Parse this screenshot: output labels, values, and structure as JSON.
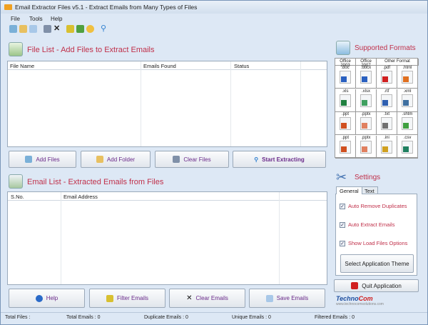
{
  "window": {
    "title": "Email Extractor Files v5.1 - Extract Emails from Many Types of Files"
  },
  "menu": [
    "File",
    "Tools",
    "Help"
  ],
  "toolbar_icons": [
    "add-files-icon",
    "add-folder-icon",
    "copy-icon",
    "window-icon",
    "close-icon",
    "filter-icon",
    "save-icon",
    "key-icon",
    "search-icon"
  ],
  "file_list": {
    "title": "File List - Add Files to Extract Emails",
    "columns": [
      "File Name",
      "Emails Found",
      "Status"
    ],
    "rows": []
  },
  "file_buttons": {
    "add_files": "Add Files",
    "add_folder": "Add Folder",
    "clear_files": "Clear Files",
    "start": "Start Extracting"
  },
  "email_list": {
    "title": "Email List - Extracted Emails from Files",
    "columns": [
      "S.No.",
      "Email Address"
    ],
    "rows": []
  },
  "email_buttons": {
    "help": "Help",
    "filter": "Filter Emails",
    "clear": "Clear Emails",
    "save": "Save Emails"
  },
  "formats": {
    "title": "Supported Formats",
    "headers": [
      "Office 2003",
      "Office 2007",
      "Other Format"
    ],
    "cells": [
      ".doc",
      ".docx",
      ".pdf",
      ".html",
      ".xls",
      ".xlsx",
      ".rtf",
      ".xml",
      ".ppt",
      ".pptx",
      ".txt",
      ".shtm",
      ".ppt",
      ".pptx",
      ".ini",
      ".csv"
    ]
  },
  "settings": {
    "title": "Settings",
    "tabs": [
      "General",
      "Text"
    ],
    "options": [
      {
        "label": "Auto Remove Duplicates",
        "checked": true
      },
      {
        "label": "Auto Extract Emails",
        "checked": true
      },
      {
        "label": "Show Load Files Options",
        "checked": true
      }
    ],
    "theme_button": "Select Application Theme"
  },
  "quit_button": "Quit Application",
  "logo": {
    "name": "TechnoCom",
    "part1": "Techno",
    "part2": "Com",
    "url": "www.technocomsolutions.com"
  },
  "status": {
    "total_files": "Total Files :",
    "total_emails": "Total Emails :  0",
    "duplicate_emails": "Duplicate Emails :  0",
    "unique_emails": "Unique Emails :  0",
    "filtered_emails": "Filtered Emails :  0"
  },
  "colors": {
    "accent": "#c0304a",
    "button_text": "#6a2a8a",
    "background": "#dde8f5"
  }
}
